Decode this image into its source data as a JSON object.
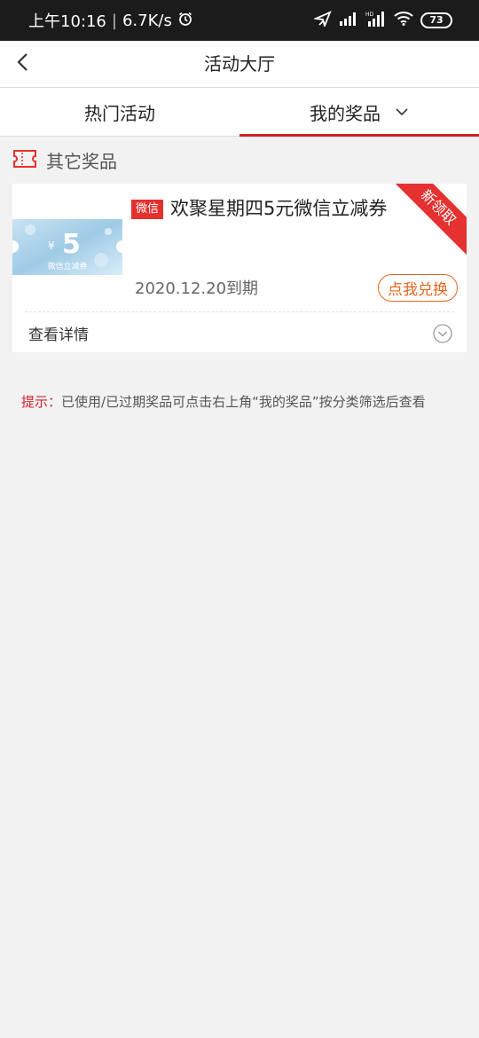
{
  "status_bar": {
    "time": "上午10:16",
    "speed": "6.7K/s",
    "battery": "73",
    "icons": [
      "alarm-icon",
      "location-icon",
      "signal-icon",
      "hd-signal-icon",
      "wifi-icon",
      "battery-icon"
    ]
  },
  "header": {
    "title": "活动大厅",
    "back_icon": "chevron-left-icon"
  },
  "tabs": [
    {
      "label": "热门活动",
      "active": false
    },
    {
      "label": "我的奖品",
      "active": true,
      "icon": "chevron-down-icon"
    }
  ],
  "section": {
    "title": "其它奖品",
    "icon": "ticket-icon"
  },
  "prize": {
    "tag": "微信",
    "title": "欢聚星期四5元微信立减券",
    "coupon_amount": "5",
    "coupon_currency": "¥",
    "coupon_caption": "微信立减券",
    "ribbon": "新领取",
    "expire": "2020.12.20到期",
    "redeem_label": "点我兑换",
    "detail_label": "查看详情"
  },
  "tip": {
    "label": "提示：",
    "text": "已使用/已过期奖品可点击右上角“我的奖品”按分类筛选后查看"
  },
  "colors": {
    "accent_red": "#d2202a",
    "orange": "#e8651e",
    "background": "#f2f2f2"
  }
}
